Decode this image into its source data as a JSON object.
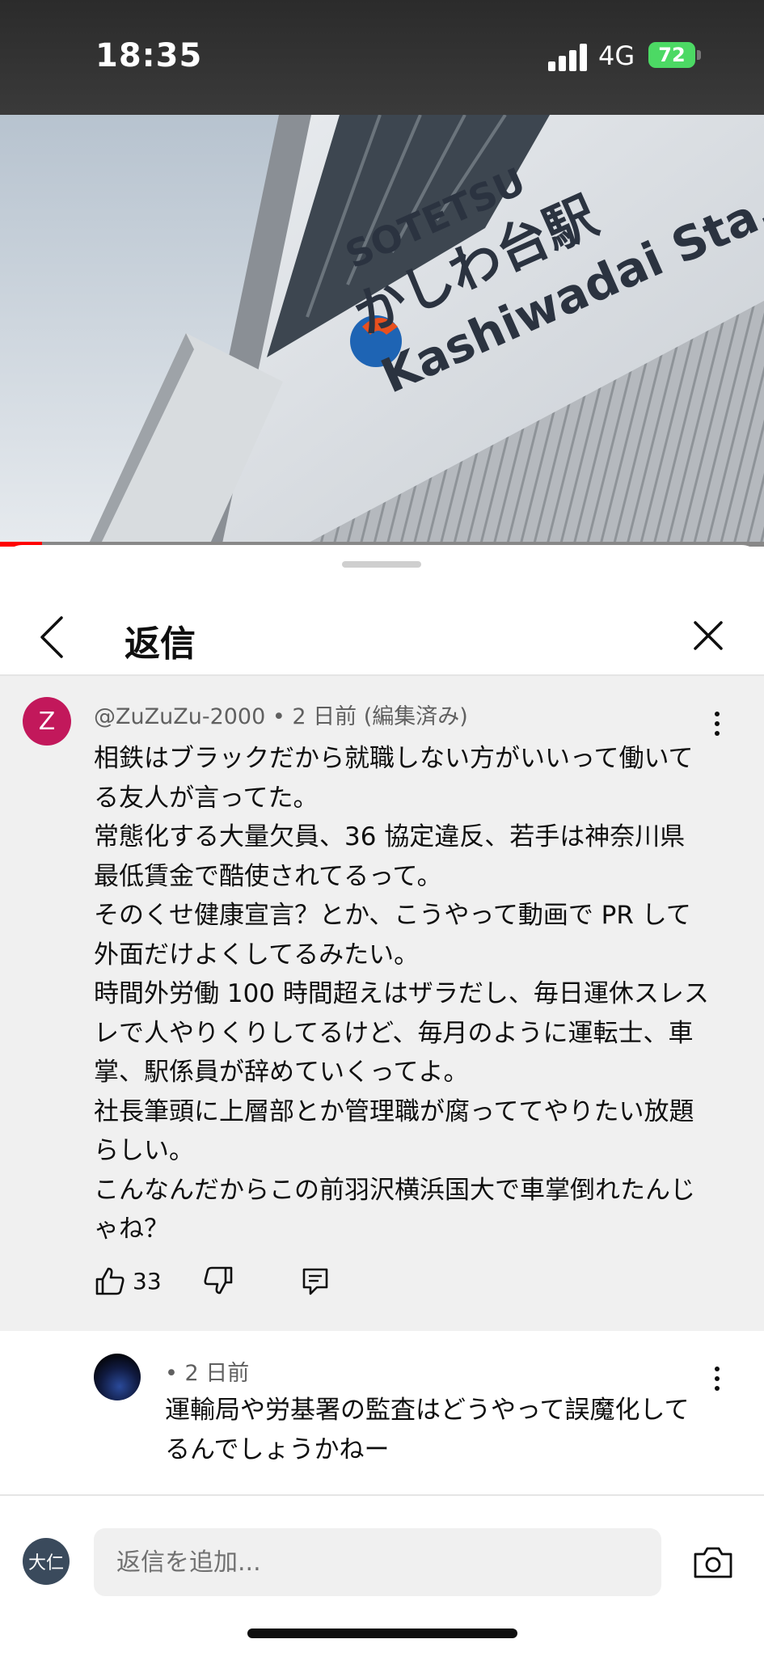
{
  "status_bar": {
    "time": "18:35",
    "network": "4G",
    "battery": "72"
  },
  "video": {
    "sign_brand": "SOTETSU",
    "sign_station_jp": "かしわ台駅",
    "sign_station_en": "Kashiwadai Sta.",
    "progress_fraction": 0.055
  },
  "header": {
    "title": "返信"
  },
  "comment": {
    "avatar_letter": "Z",
    "meta": "@ZuZuZu-2000 • 2 日前 (編集済み)",
    "lines": [
      "相鉄はブラックだから就職しない方がいいって働いて",
      "る友人が言ってた。",
      "常態化する大量欠員、36 協定違反、若手は神奈川県",
      "最低賃金で酷使されてるって。",
      "そのくせ健康宣言？とか、こうやって動画で PR して",
      "外面だけよくしてるみたい。",
      "時間外労働 100 時間超えはザラだし、毎日運休スレス",
      "レで人やりくりしてるけど、毎月のように運転士、車",
      "掌、駅係員が辞めていくってよ。",
      "社長筆頭に上層部とか管理職が腐っててやりたい放題",
      "らしい。",
      "こんなんだからこの前羽沢横浜国大で車掌倒れたんじ",
      "ゃね？"
    ],
    "like_count": "33"
  },
  "reply": {
    "meta": "• 2 日前",
    "lines": [
      "運輸局や労基署の監査はどうやって誤魔化して",
      "るんでしょうかねー"
    ]
  },
  "composer": {
    "avatar_text": "大仁",
    "placeholder": "返信を追加..."
  },
  "colors": {
    "accent_red": "#ff0000",
    "avatar_z": "#c2185b",
    "battery": "#4cd964"
  }
}
